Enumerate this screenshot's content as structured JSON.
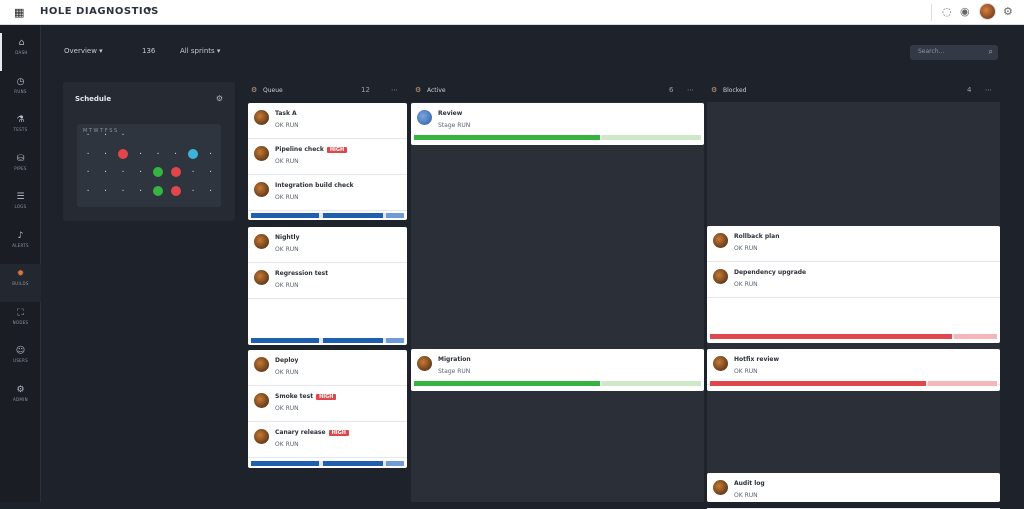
{
  "app": {
    "title": "HOLE DIAGNOSTICS",
    "caret": "▾",
    "logo_icon": "grid-logo-icon",
    "top_icons": [
      "help-icon",
      "notification-icon",
      "user-avatar",
      "settings-icon"
    ]
  },
  "sidebar": {
    "items": [
      {
        "label": "DASH",
        "icon": "home-icon",
        "glyph": "⌂"
      },
      {
        "label": "RUNS",
        "icon": "clock-icon",
        "glyph": "◷"
      },
      {
        "label": "TESTS",
        "icon": "flask-icon",
        "glyph": "⚗"
      },
      {
        "label": "PIPES",
        "icon": "pipeline-icon",
        "glyph": "⛁"
      },
      {
        "label": "LOGS",
        "icon": "list-icon",
        "glyph": "☰"
      },
      {
        "label": "ALERTS",
        "icon": "bell-icon",
        "glyph": "♪"
      },
      {
        "label": "BUILDS",
        "icon": "flame-icon",
        "glyph": "✹"
      },
      {
        "label": "NODES",
        "icon": "node-icon",
        "glyph": "⛶"
      },
      {
        "label": "USERS",
        "icon": "user-icon",
        "glyph": "☺"
      },
      {
        "label": "ADMIN",
        "icon": "gear-icon",
        "glyph": "⚙"
      }
    ]
  },
  "filters": {
    "status": "Overview ▾",
    "count": "136",
    "range": "All sprints ▾",
    "search_placeholder": "Search..."
  },
  "mini_panel": {
    "title": "Schedule",
    "cal_head": "M T W T F S S"
  },
  "columns": [
    {
      "title": "Queue",
      "count": "12"
    },
    {
      "title": "Active",
      "count": "6"
    },
    {
      "title": "Blocked",
      "count": "4"
    }
  ],
  "lanes": {
    "queue": [
      [
        {
          "name": "Task A",
          "sub": "OK  RUN",
          "tag": ""
        },
        {
          "name": "Pipeline check",
          "sub": "OK  RUN",
          "tag": "HIGH"
        },
        {
          "name": "Integration build check",
          "sub": "OK  RUN",
          "tag": ""
        }
      ],
      [
        {
          "name": "Nightly",
          "sub": "OK  RUN",
          "tag": ""
        },
        {
          "name": "Regression test",
          "sub": "OK  RUN",
          "tag": ""
        }
      ],
      [
        {
          "name": "Deploy",
          "sub": "OK  RUN",
          "tag": ""
        },
        {
          "name": "Smoke test",
          "sub": "OK  RUN",
          "tag": "HIGH"
        },
        {
          "name": "Canary release",
          "sub": "OK  RUN",
          "tag": "HIGH"
        }
      ]
    ],
    "active": [
      {
        "name": "Review",
        "sub": "Stage  RUN"
      },
      {
        "name": "Migration",
        "sub": "Stage  RUN"
      }
    ],
    "blocked": [
      [
        {
          "name": "Rollback plan",
          "sub": "OK  RUN"
        },
        {
          "name": "Dependency upgrade",
          "sub": "OK  RUN"
        }
      ],
      [
        {
          "name": "Hotfix review",
          "sub": "OK  RUN"
        }
      ],
      [
        {
          "name": "Audit log",
          "sub": "OK  RUN"
        }
      ]
    ]
  },
  "colors": {
    "blue": "#1f5fb0",
    "green": "#36b43f",
    "red": "#e0474c",
    "bg": "#1e222a"
  }
}
